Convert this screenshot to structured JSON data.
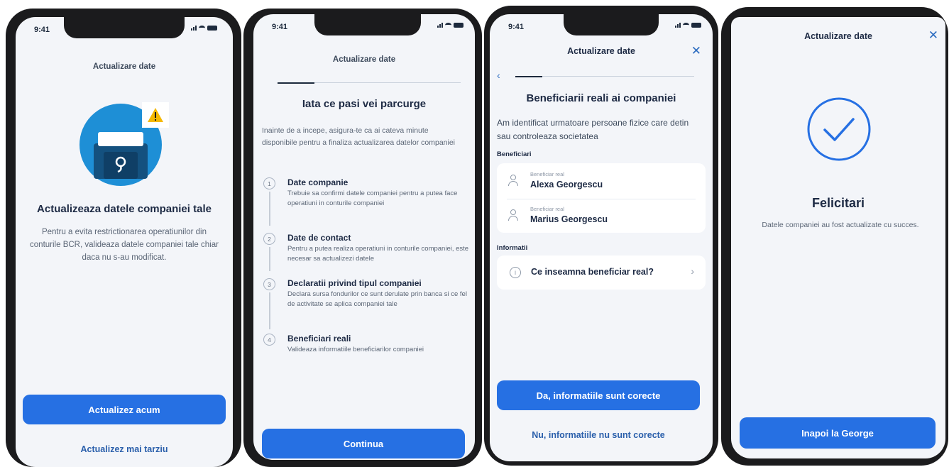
{
  "status_time": "9:41",
  "screens": [
    {
      "header_title": "Actualizare date",
      "title": "Actualizeaza datele companiei tale",
      "body": "Pentru a evita restrictionarea operatiunilor din conturile BCR, valideaza datele companiei tale chiar daca nu s-au modificat.",
      "primary_button": "Actualizez acum",
      "secondary_link": "Actualizez mai tarziu",
      "illustration_icons": [
        "company-illustration-icon",
        "warning-icon"
      ]
    },
    {
      "header_title": "Actualizare date",
      "progress": 0.2,
      "title": "Iata ce pasi vei parcurge",
      "intro": "Inainte de a incepe, asigura-te ca ai cateva minute disponibile pentru a finaliza actualizarea datelor companiei",
      "steps": [
        {
          "num": "1",
          "title": "Date companie",
          "desc": "Trebuie sa confirmi datele companiei pentru a putea face operatiuni in conturile companiei"
        },
        {
          "num": "2",
          "title": "Date de contact",
          "desc": "Pentru a putea realiza operatiuni in conturile companiei, este necesar sa actualizezi datele"
        },
        {
          "num": "3",
          "title": "Declaratii privind tipul companiei",
          "desc": "Declara sursa fondurilor ce sunt derulate prin banca si ce fel de activitate se aplica companiei tale"
        },
        {
          "num": "4",
          "title": "Beneficiari reali",
          "desc": "Valideaza informatiile beneficiarilor companiei"
        }
      ],
      "primary_button": "Continua"
    },
    {
      "header_title": "Actualizare date",
      "progress": 0.15,
      "title": "Beneficiarii reali ai companiei",
      "intro": "Am identificat urmatoare persoane fizice care detin sau controleaza societatea",
      "beneficiari_label": "Beneficiari",
      "beneficiaries": [
        {
          "caption": "Beneficiar real",
          "name": "Alexa Georgescu"
        },
        {
          "caption": "Beneficiar real",
          "name": "Marius Georgescu"
        }
      ],
      "informatii_label": "Informatii",
      "info_item": "Ce inseamna beneficiar real?",
      "primary_button": "Da, informatiile sunt corecte",
      "secondary_link": "Nu, informatiile nu sunt corecte"
    },
    {
      "header_title": "Actualizare date",
      "title": "Felicitari",
      "body": "Datele companiei au fost actualizate cu succes.",
      "primary_button": "Inapoi la George"
    }
  ],
  "icons": {
    "close": "close-icon",
    "back": "chevron-left-icon",
    "info": "info-icon",
    "chevron": "chevron-right-icon",
    "success": "check-circle-icon",
    "person": "person-icon"
  },
  "colors": {
    "primary": "#2670e3",
    "link": "#2a5fab",
    "background": "#f3f5f9",
    "warning": "#f5b800",
    "illustration": "#1e8fd6",
    "text_dark": "#1d2a44"
  }
}
